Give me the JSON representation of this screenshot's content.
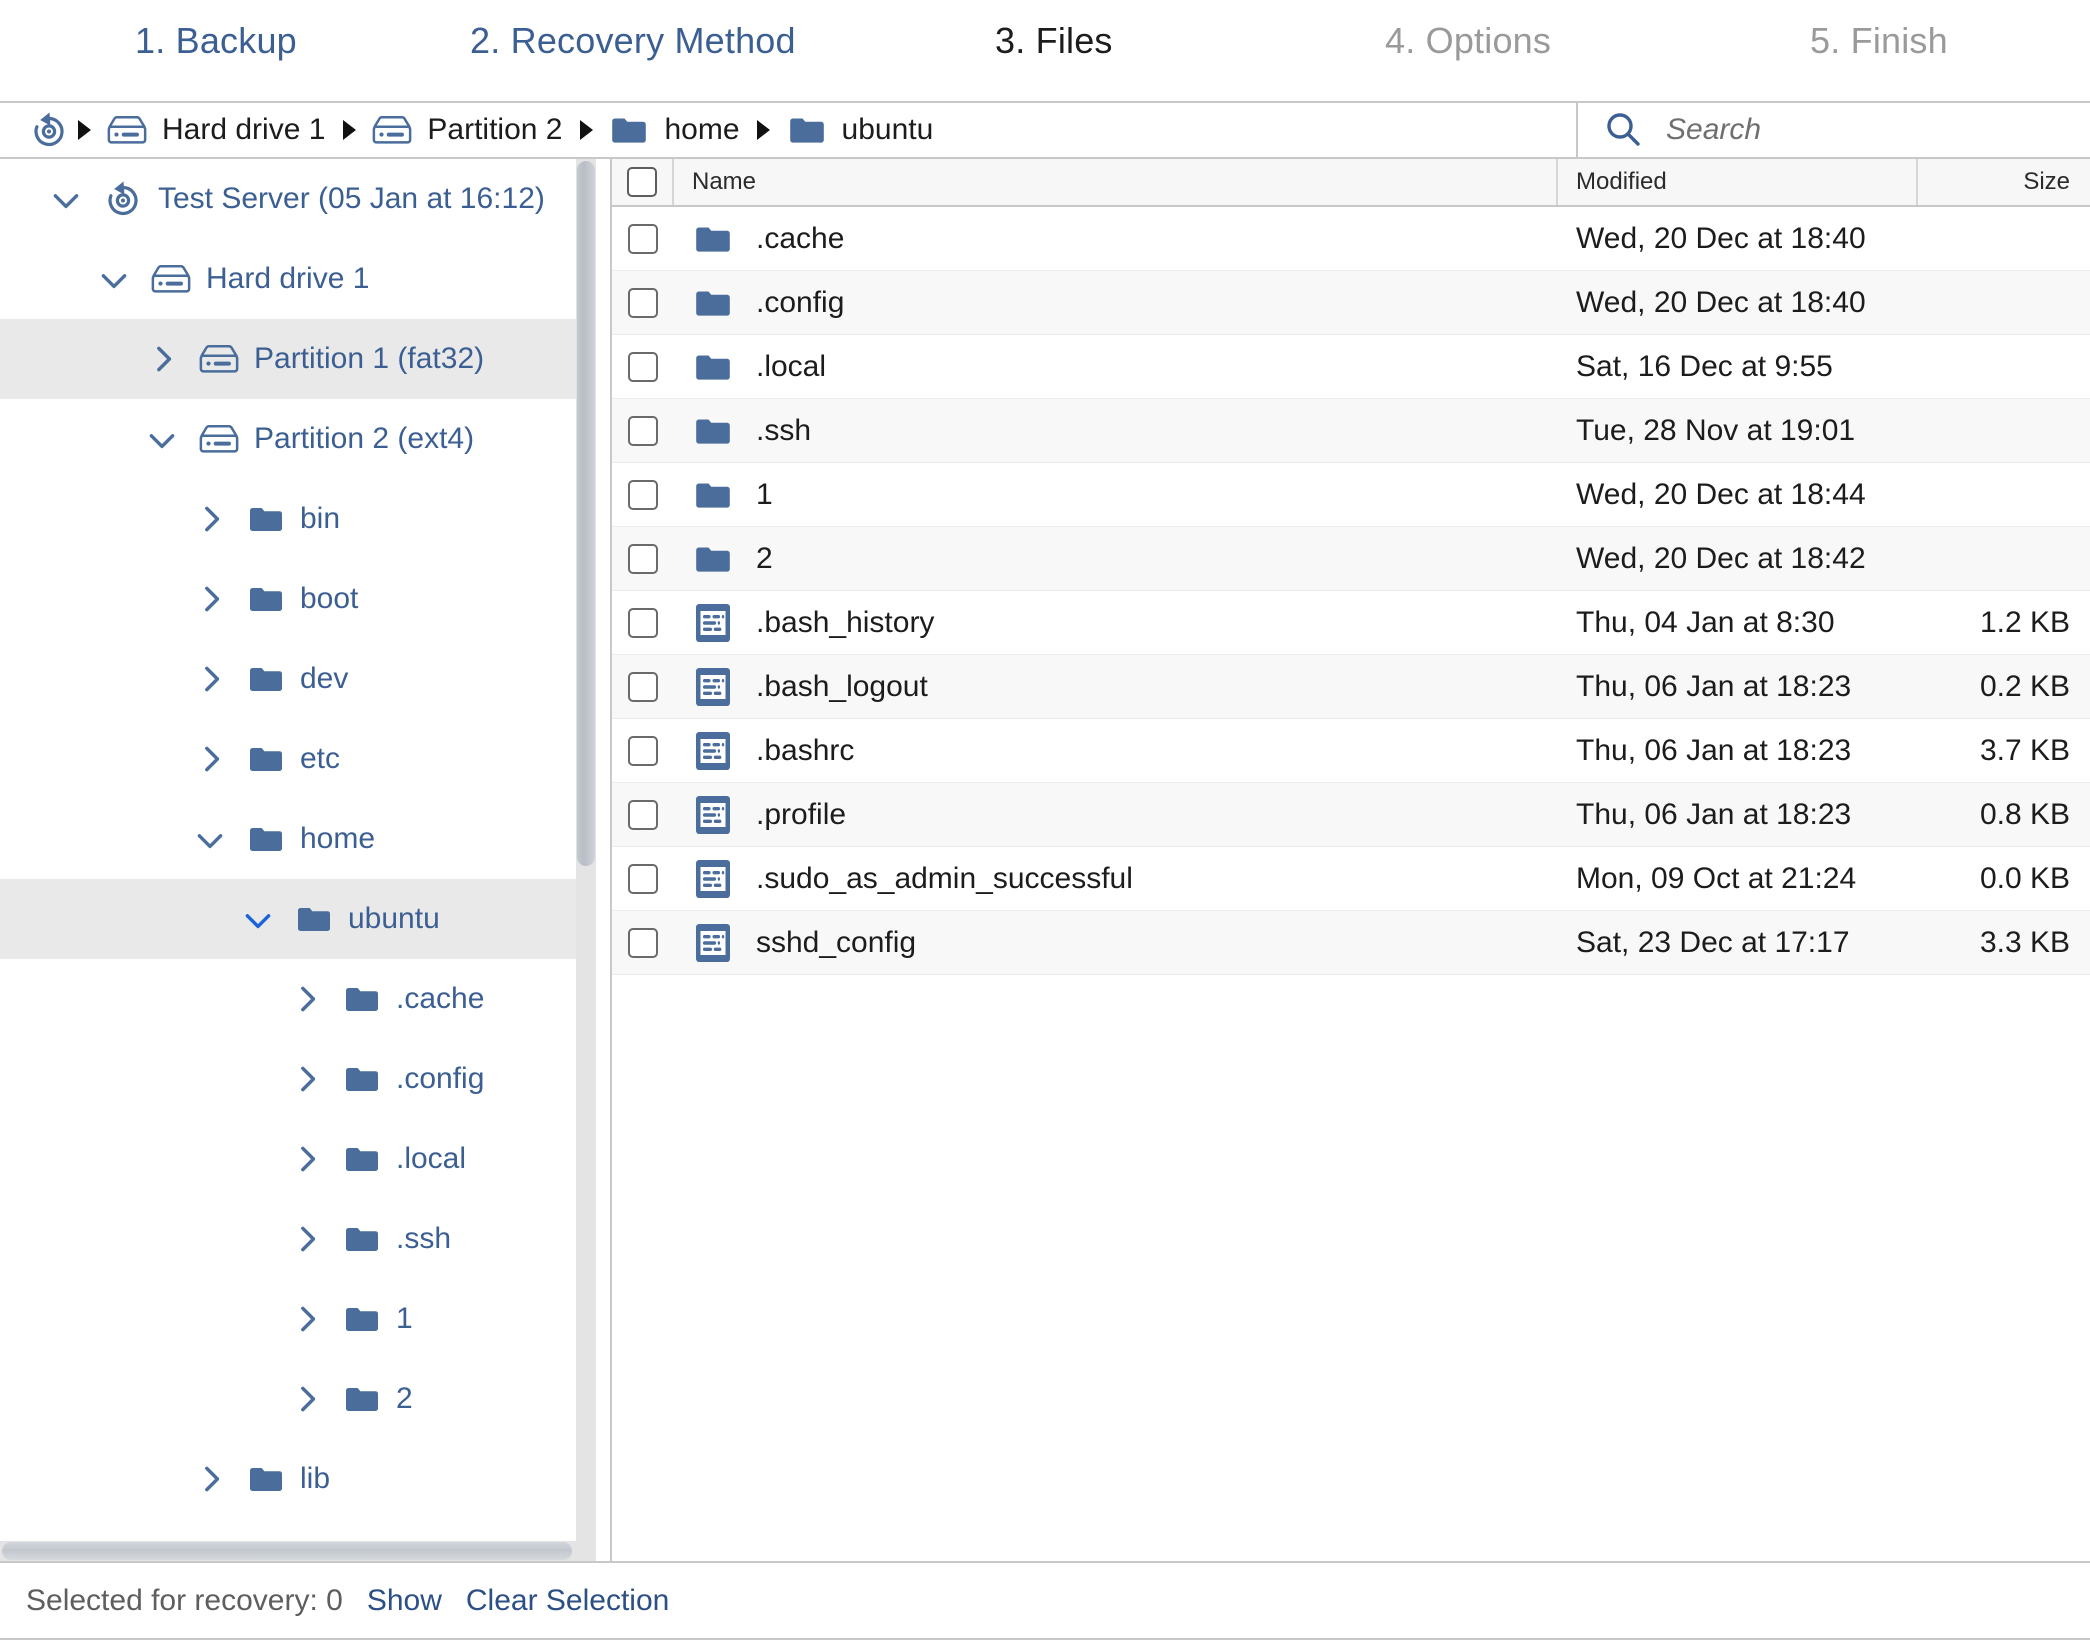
{
  "wizard": {
    "steps": [
      {
        "label": "1. Backup",
        "state": "done"
      },
      {
        "label": "2. Recovery Method",
        "state": "done"
      },
      {
        "label": "3. Files",
        "state": "active"
      },
      {
        "label": "4. Options",
        "state": "todo"
      },
      {
        "label": "5. Finish",
        "state": "todo"
      }
    ]
  },
  "breadcrumb": {
    "items": [
      {
        "label": "",
        "icon": "restore-point-icon"
      },
      {
        "label": "Hard drive 1",
        "icon": "drive-icon"
      },
      {
        "label": "Partition 2",
        "icon": "drive-icon"
      },
      {
        "label": "home",
        "icon": "folder-icon"
      },
      {
        "label": "ubuntu",
        "icon": "folder-icon"
      }
    ]
  },
  "search": {
    "placeholder": "Search",
    "value": "",
    "icon": "search-icon"
  },
  "tree": {
    "nodes": [
      {
        "label": "Test Server (05 Jan at 16:12)",
        "icon": "restore-point-icon",
        "indent": 0,
        "chevron": "down",
        "selected": false
      },
      {
        "label": "Hard drive 1",
        "icon": "drive-icon",
        "indent": 1,
        "chevron": "down",
        "selected": false
      },
      {
        "label": "Partition 1 (fat32)",
        "icon": "drive-icon",
        "indent": 2,
        "chevron": "right",
        "selected": true
      },
      {
        "label": "Partition 2 (ext4)",
        "icon": "drive-icon",
        "indent": 2,
        "chevron": "down",
        "selected": false
      },
      {
        "label": "bin",
        "icon": "folder-icon",
        "indent": 3,
        "chevron": "right",
        "selected": false
      },
      {
        "label": "boot",
        "icon": "folder-icon",
        "indent": 3,
        "chevron": "right",
        "selected": false
      },
      {
        "label": "dev",
        "icon": "folder-icon",
        "indent": 3,
        "chevron": "right",
        "selected": false
      },
      {
        "label": "etc",
        "icon": "folder-icon",
        "indent": 3,
        "chevron": "right",
        "selected": false
      },
      {
        "label": "home",
        "icon": "folder-icon",
        "indent": 3,
        "chevron": "down",
        "selected": false
      },
      {
        "label": "ubuntu",
        "icon": "folder-icon",
        "indent": 4,
        "chevron": "down",
        "selected": true
      },
      {
        "label": ".cache",
        "icon": "folder-icon",
        "indent": 5,
        "chevron": "right",
        "selected": false
      },
      {
        "label": ".config",
        "icon": "folder-icon",
        "indent": 5,
        "chevron": "right",
        "selected": false
      },
      {
        "label": ".local",
        "icon": "folder-icon",
        "indent": 5,
        "chevron": "right",
        "selected": false
      },
      {
        "label": ".ssh",
        "icon": "folder-icon",
        "indent": 5,
        "chevron": "right",
        "selected": false
      },
      {
        "label": "1",
        "icon": "folder-icon",
        "indent": 5,
        "chevron": "right",
        "selected": false
      },
      {
        "label": "2",
        "icon": "folder-icon",
        "indent": 5,
        "chevron": "right",
        "selected": false
      },
      {
        "label": "lib",
        "icon": "folder-icon",
        "indent": 3,
        "chevron": "right",
        "selected": false
      }
    ]
  },
  "filelist": {
    "columns": {
      "name": "Name",
      "modified": "Modified",
      "size": "Size"
    },
    "rows": [
      {
        "name": ".cache",
        "modified": "Wed, 20 Dec at 18:40",
        "size": "",
        "type": "folder",
        "checked": false
      },
      {
        "name": ".config",
        "modified": "Wed, 20 Dec at 18:40",
        "size": "",
        "type": "folder",
        "checked": false
      },
      {
        "name": ".local",
        "modified": "Sat, 16 Dec at 9:55",
        "size": "",
        "type": "folder",
        "checked": false
      },
      {
        "name": ".ssh",
        "modified": "Tue, 28 Nov at 19:01",
        "size": "",
        "type": "folder",
        "checked": false
      },
      {
        "name": "1",
        "modified": "Wed, 20 Dec at 18:44",
        "size": "",
        "type": "folder",
        "checked": false
      },
      {
        "name": "2",
        "modified": "Wed, 20 Dec at 18:42",
        "size": "",
        "type": "folder",
        "checked": false
      },
      {
        "name": ".bash_history",
        "modified": "Thu, 04 Jan at 8:30",
        "size": "1.2 KB",
        "type": "file",
        "checked": false
      },
      {
        "name": ".bash_logout",
        "modified": "Thu, 06 Jan at 18:23",
        "size": "0.2 KB",
        "type": "file",
        "checked": false
      },
      {
        "name": ".bashrc",
        "modified": "Thu, 06 Jan at 18:23",
        "size": "3.7 KB",
        "type": "file",
        "checked": false
      },
      {
        "name": ".profile",
        "modified": "Thu, 06 Jan at 18:23",
        "size": "0.8 KB",
        "type": "file",
        "checked": false
      },
      {
        "name": ".sudo_as_admin_successful",
        "modified": "Mon, 09 Oct at 21:24",
        "size": "0.0 KB",
        "type": "file",
        "checked": false
      },
      {
        "name": "sshd_config",
        "modified": "Sat, 23 Dec at 17:17",
        "size": "3.3 KB",
        "type": "file",
        "checked": false
      }
    ]
  },
  "status": {
    "selected_text": "Selected for recovery: 0",
    "show_label": "Show",
    "clear_label": "Clear Selection"
  },
  "colors": {
    "accent": "#3c5f93",
    "link": "#2c4f85",
    "muted": "#9a9a9a",
    "selection_row": "#e9e9e9",
    "alt_row": "#f8f8f8"
  }
}
